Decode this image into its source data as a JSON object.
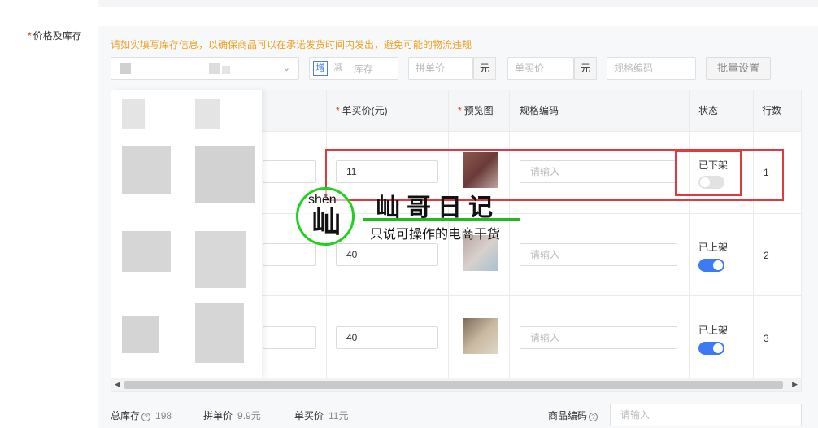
{
  "section": {
    "label": "价格及库存",
    "required_mark": "*"
  },
  "notice": "请如实填写库存信息，以确保商品可以在承诺发货时间内发出，避免可能的物流违规",
  "batch": {
    "add_label": "增",
    "sub_label": "减",
    "stock_placeholder": "库存",
    "group_price_placeholder": "拼单价",
    "single_price_placeholder": "单买价",
    "currency_unit": "元",
    "spec_code_placeholder": "规格编码",
    "batch_button": "批量设置"
  },
  "table": {
    "headers": {
      "col_partial": ")",
      "single_price": "单买价(元)",
      "preview": "预览图",
      "spec_code": "规格编码",
      "status": "状态",
      "row_no": "行数"
    },
    "required_mark": "*",
    "input_placeholder": "请输入",
    "rows": [
      {
        "single_price": "11",
        "status": "已下架",
        "enabled": false,
        "row_no": "1"
      },
      {
        "single_price": "40",
        "status": "已上架",
        "enabled": true,
        "row_no": "2"
      },
      {
        "single_price": "40",
        "status": "已上架",
        "enabled": true,
        "row_no": "3"
      }
    ]
  },
  "watermark": {
    "pinyin": "shēn",
    "glyph": "屾",
    "title": "屾哥日记",
    "subtitle": "只说可操作的电商干货"
  },
  "footer": {
    "total_stock_label": "总库存",
    "total_stock_value": "198",
    "group_price_label": "拼单价",
    "group_price_value": "9.9元",
    "single_price_label": "单买价",
    "single_price_value": "11元",
    "product_code_label": "商品编码",
    "product_code_placeholder": "请输入"
  },
  "colors": {
    "accent": "#3d7bf5",
    "highlight": "#e0393e",
    "notice": "#f0a020",
    "required": "#e02e24",
    "watermark_green": "#22d022"
  }
}
